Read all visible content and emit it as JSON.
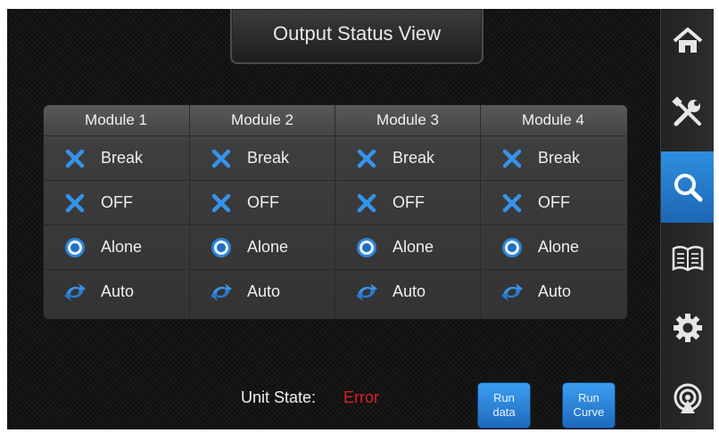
{
  "header": {
    "title": "Output Status View"
  },
  "modules": [
    {
      "name": "Module 1",
      "rows": [
        "Break",
        "OFF",
        "Alone",
        "Auto"
      ]
    },
    {
      "name": "Module 2",
      "rows": [
        "Break",
        "OFF",
        "Alone",
        "Auto"
      ]
    },
    {
      "name": "Module 3",
      "rows": [
        "Break",
        "OFF",
        "Alone",
        "Auto"
      ]
    },
    {
      "name": "Module 4",
      "rows": [
        "Break",
        "OFF",
        "Alone",
        "Auto"
      ]
    }
  ],
  "row_icons": [
    "x-icon",
    "x-icon",
    "radio-on-icon",
    "auto-cycle-icon"
  ],
  "status": {
    "label": "Unit State:",
    "value": "Error",
    "value_color": "#e02020"
  },
  "buttons": {
    "run_data": [
      "Run",
      "data"
    ],
    "run_curve": [
      "Run",
      "Curve"
    ]
  },
  "sidebar": {
    "items": [
      {
        "icon": "home-icon",
        "active": false
      },
      {
        "icon": "tools-icon",
        "active": false
      },
      {
        "icon": "search-icon",
        "active": true
      },
      {
        "icon": "book-icon",
        "active": false
      },
      {
        "icon": "gear-icon",
        "active": false
      },
      {
        "icon": "signal-icon",
        "active": false
      }
    ]
  },
  "colors": {
    "accent": "#2a86d8",
    "background": "#111111"
  }
}
